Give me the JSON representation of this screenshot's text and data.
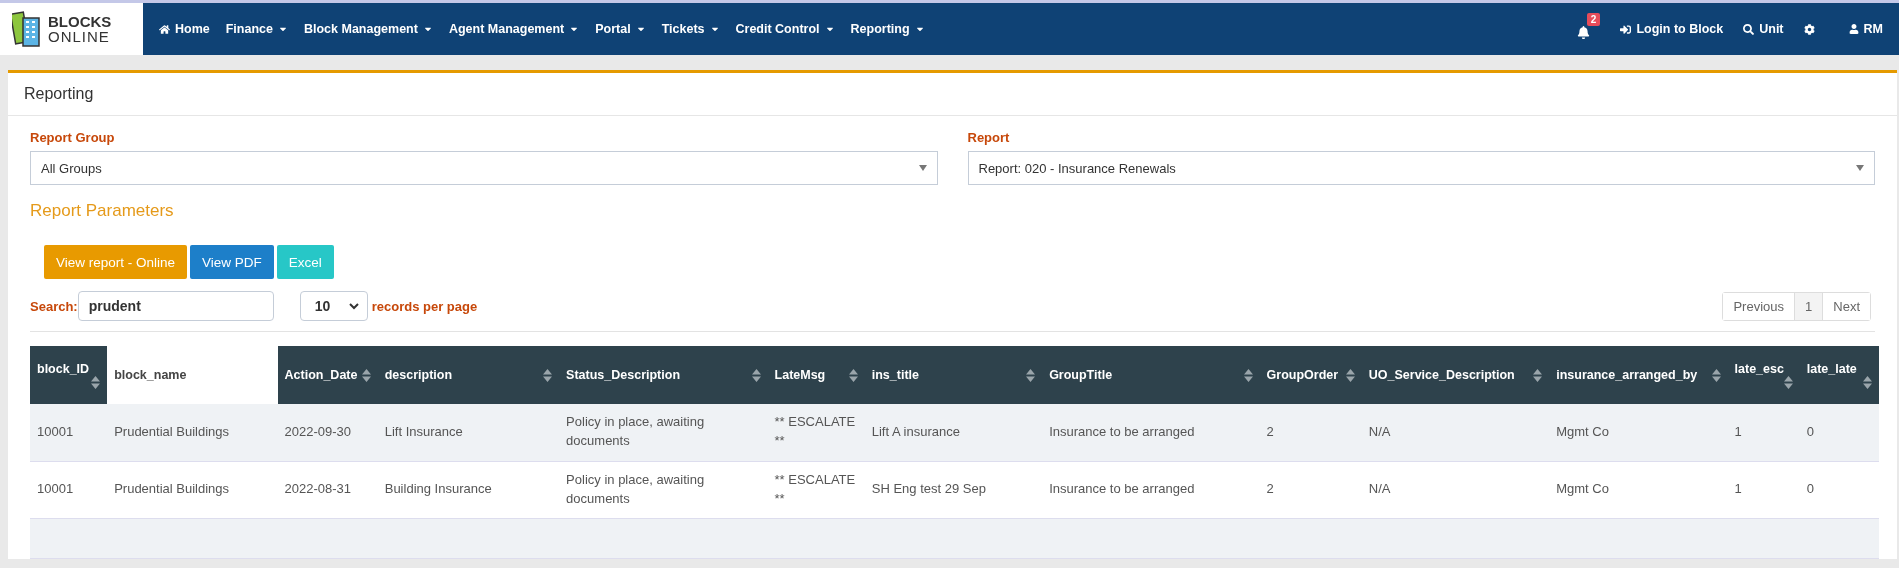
{
  "logo": {
    "line1": "BLOCKS",
    "line2": "ONLINE"
  },
  "nav": [
    {
      "label": "Home",
      "kind": "home",
      "dropdown": false
    },
    {
      "label": "Finance",
      "kind": "menu",
      "dropdown": true
    },
    {
      "label": "Block Management",
      "kind": "menu",
      "dropdown": true
    },
    {
      "label": "Agent Management",
      "kind": "menu",
      "dropdown": true
    },
    {
      "label": "Portal",
      "kind": "menu",
      "dropdown": true
    },
    {
      "label": "Tickets",
      "kind": "menu",
      "dropdown": true
    },
    {
      "label": "Credit Control",
      "kind": "menu",
      "dropdown": true
    },
    {
      "label": "Reporting",
      "kind": "menu",
      "dropdown": true
    }
  ],
  "nav_right": [
    {
      "kind": "bell",
      "badge": "2"
    },
    {
      "kind": "login",
      "label": "Login to Block"
    },
    {
      "kind": "search",
      "label": "Unit"
    },
    {
      "kind": "gear"
    },
    {
      "kind": "user",
      "label": "RM"
    }
  ],
  "panel_title": "Reporting",
  "report_group": {
    "label": "Report Group",
    "value": "All Groups"
  },
  "report": {
    "label": "Report",
    "value": "Report: 020 - Insurance Renewals"
  },
  "parameters_title": "Report Parameters",
  "buttons": [
    {
      "label": "View report - Online",
      "kind": "orange"
    },
    {
      "label": "View PDF",
      "kind": "blue"
    },
    {
      "label": "Excel",
      "kind": "teal"
    }
  ],
  "search": {
    "label": "Search:",
    "value": "prudent"
  },
  "page_size": {
    "value": "10",
    "label": "records per page"
  },
  "pagination": [
    {
      "label": "Previous",
      "selected": false
    },
    {
      "label": "1",
      "selected": true
    },
    {
      "label": "Next",
      "selected": false
    }
  ],
  "table": {
    "columns": [
      {
        "label": "block_ID",
        "sortable": true,
        "selected": false,
        "wrap": true
      },
      {
        "label": "block_name",
        "sortable": false,
        "selected": true,
        "wrap": false
      },
      {
        "label": "Action_Date",
        "sortable": true,
        "selected": false,
        "wrap": false
      },
      {
        "label": "description",
        "sortable": true,
        "selected": false,
        "wrap": false
      },
      {
        "label": "Status_Description",
        "sortable": true,
        "selected": false,
        "wrap": false
      },
      {
        "label": "LateMsg",
        "sortable": true,
        "selected": false,
        "wrap": false
      },
      {
        "label": "ins_title",
        "sortable": true,
        "selected": false,
        "wrap": false
      },
      {
        "label": "GroupTitle",
        "sortable": true,
        "selected": false,
        "wrap": false
      },
      {
        "label": "GroupOrder",
        "sortable": true,
        "selected": false,
        "wrap": false
      },
      {
        "label": "UO_Service_Description",
        "sortable": true,
        "selected": false,
        "wrap": false
      },
      {
        "label": "insurance_arranged_by",
        "sortable": true,
        "selected": false,
        "wrap": false
      },
      {
        "label": "late_esc",
        "sortable": true,
        "selected": false,
        "wrap": true
      },
      {
        "label": "late_late",
        "sortable": true,
        "selected": false,
        "wrap": true
      }
    ],
    "rows": [
      [
        "10001",
        "Prudential Buildings",
        "2022-09-30",
        "Lift Insurance",
        "Policy in place, awaiting documents",
        "** ESCALATE **",
        "Lift A insurance",
        "Insurance to be arranged",
        "2",
        "N/A",
        "Mgmt Co",
        "1",
        "0"
      ],
      [
        "10001",
        "Prudential Buildings",
        "2022-08-31",
        "Building Insurance",
        "Policy in place, awaiting documents",
        "** ESCALATE **",
        "SH Eng test 29 Sep",
        "Insurance to be arranged",
        "2",
        "N/A",
        "Mgmt Co",
        "1",
        "0"
      ]
    ]
  }
}
